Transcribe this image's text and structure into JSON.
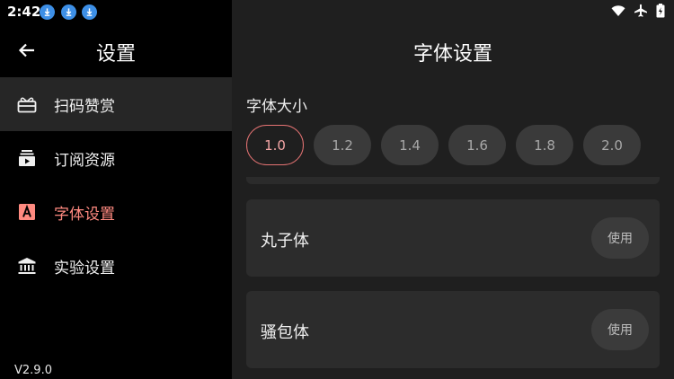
{
  "status_bar": {
    "time": "2:42",
    "download_icons": [
      "download-icon",
      "download-icon",
      "download-icon"
    ],
    "right_icons": [
      "wifi-icon",
      "airplane-icon",
      "battery-icon"
    ]
  },
  "sidebar": {
    "title": "设置",
    "back_icon": "arrow-left-icon",
    "items": [
      {
        "label": "扫码赞赏",
        "icon": "gift-icon"
      },
      {
        "label": "订阅资源",
        "icon": "subscription-icon"
      },
      {
        "label": "字体设置",
        "icon": "font-icon"
      },
      {
        "label": "实验设置",
        "icon": "bank-icon"
      }
    ],
    "version": "V2.9.0"
  },
  "main": {
    "title": "字体设置",
    "size_label": "字体大小",
    "sizes": [
      "1.0",
      "1.2",
      "1.4",
      "1.6",
      "1.8",
      "2.0"
    ],
    "selected_size": "1.0",
    "fonts": [
      {
        "name": "丸子体",
        "button": "使用"
      },
      {
        "name": "骚包体",
        "button": "使用"
      }
    ]
  },
  "colors": {
    "accent": "#e57373",
    "active_item_bg": "#262626",
    "main_bg": "#1f1f1f",
    "card_bg": "#2c2c2c"
  }
}
